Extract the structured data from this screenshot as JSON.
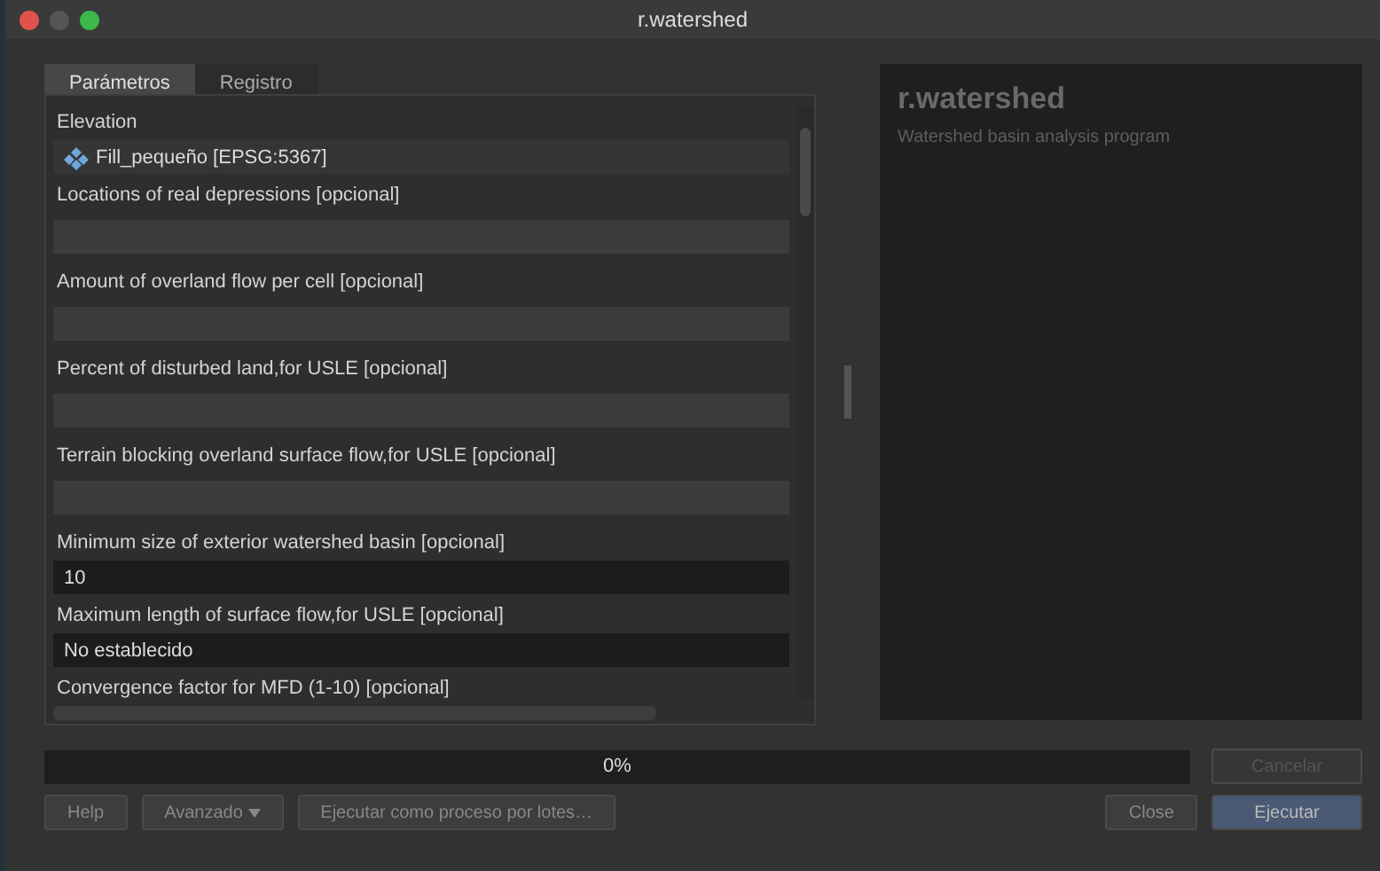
{
  "window": {
    "title": "r.watershed"
  },
  "tabs": [
    {
      "label": "Parámetros",
      "selected": true
    },
    {
      "label": "Registro",
      "selected": false
    }
  ],
  "parameters": [
    {
      "label": "Elevation",
      "kind": "layer",
      "value": "Fill_pequeño [EPSG:5367]"
    },
    {
      "label": "Locations of real depressions [opcional]",
      "kind": "empty"
    },
    {
      "label": "Amount of overland flow per cell [opcional]",
      "kind": "empty"
    },
    {
      "label": "Percent of disturbed land,for USLE [opcional]",
      "kind": "empty"
    },
    {
      "label": "Terrain blocking overland surface flow,for USLE [opcional]",
      "kind": "empty"
    },
    {
      "label": "Minimum size of exterior watershed basin [opcional]",
      "kind": "text",
      "value": "10"
    },
    {
      "label": "Maximum length of surface flow,for USLE [opcional]",
      "kind": "text",
      "value": "No establecido"
    },
    {
      "label": "Convergence factor for MFD (1-10) [opcional]",
      "kind": "none"
    }
  ],
  "help": {
    "title": "r.watershed",
    "description": "Watershed basin analysis program"
  },
  "progress": {
    "level": 0,
    "reading": "0%"
  },
  "buttons": [
    {
      "label": "Help",
      "kind": "plain"
    },
    {
      "label": "Avanzado",
      "kind": "menu"
    },
    {
      "label": "Ejecutar como proceso por lotes…",
      "kind": "plain"
    },
    {
      "label": "Close",
      "kind": "plain"
    },
    {
      "label": "Ejecutar",
      "kind": "default"
    }
  ],
  "cancel_button": {
    "label": "Cancelar",
    "disabled": true
  }
}
